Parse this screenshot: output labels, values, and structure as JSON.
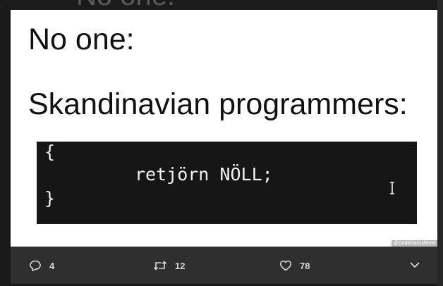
{
  "top_text": "No one:",
  "meme": {
    "line1": "No one:",
    "line2": "Skandinavian programmers:",
    "code": {
      "open": "{",
      "body": "retjörn NÖLL;",
      "close": "}"
    },
    "watermark": "@CodeDocsMeme"
  },
  "actions": {
    "reply_count": "4",
    "retweet_count": "12",
    "like_count": "78"
  },
  "icons": {
    "reply": "reply-icon",
    "retweet": "retweet-icon",
    "like": "heart-icon",
    "more": "chevron-down-icon",
    "cursor": "text-cursor-icon"
  }
}
